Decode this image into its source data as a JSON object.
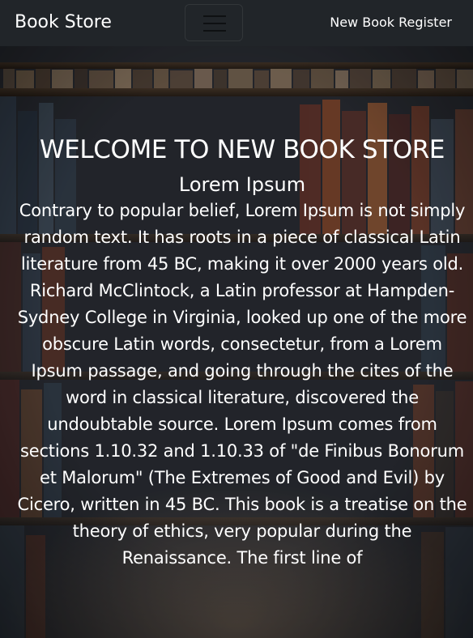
{
  "navbar": {
    "brand": "Book Store",
    "toggler_icon": "hamburger-menu-icon",
    "link_label": "New Book Register"
  },
  "hero": {
    "headline": "WELCOME TO NEW BOOK STORE",
    "subheading": "Lorem Ipsum",
    "body": "Contrary to popular belief, Lorem Ipsum is not simply random text. It has roots in a piece of classical Latin literature from 45 BC, making it over 2000 years old. Richard McClintock, a Latin professor at Hampden-Sydney College in Virginia, looked up one of the more obscure Latin words, consectetur, from a Lorem Ipsum passage, and going through the cites of the word in classical literature, discovered the undoubtable source. Lorem Ipsum comes from sections 1.10.32 and 1.10.33 of \"de Finibus Bonorum et Malorum\" (The Extremes of Good and Evil) by Cicero, written in 45 BC. This book is a treatise on the theory of ethics, very popular during the Renaissance. The first line of"
  },
  "colors": {
    "navbar_bg": "#212529",
    "text": "#ffffff"
  }
}
